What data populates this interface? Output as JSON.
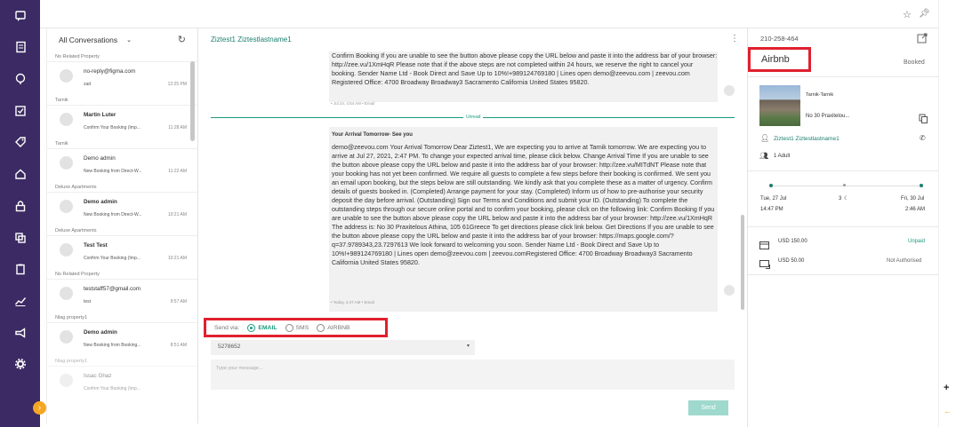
{
  "sidebar": {
    "items": [
      "chat-icon",
      "book-icon",
      "brain-icon",
      "checklist-icon",
      "tag-icon",
      "home-icon",
      "lock-icon",
      "copy-icon",
      "clipboard-icon",
      "analytics-icon",
      "megaphone-icon",
      "settings-icon"
    ]
  },
  "conversations": {
    "filter_label": "All Conversations",
    "groups": [
      {
        "label": "No Related Property",
        "name": "no-reply@figma.com",
        "preview": "zad",
        "time": "12:25 PM",
        "bold": false
      },
      {
        "label": "Tarnik",
        "name": "Martin Luter",
        "preview": "Confirm Your Booking (Imp...",
        "time": "11:28 AM",
        "bold": true
      },
      {
        "label": "Tarnik",
        "name": "Demo admin",
        "preview": "New Booking from Direct-W...",
        "time": "11:22 AM",
        "bold": false
      },
      {
        "label": "Deluxe Apartments",
        "name": "Demo admin",
        "preview": "New Booking from Direct-W...",
        "time": "10:21 AM",
        "bold": true
      },
      {
        "label": "Deluxe Apartments",
        "name": "Test Test",
        "preview": "Confirm Your Booking (Imp...",
        "time": "10:21 AM",
        "bold": true
      },
      {
        "label": "No Related Property",
        "name": "teststaff57@gmail.com",
        "preview": "test",
        "time": "9:57 AM",
        "bold": false
      },
      {
        "label": "Nlag property1",
        "name": "Demo admin",
        "preview": "New Booking from Booking...",
        "time": "8:51 AM",
        "bold": true
      },
      {
        "label": "Nlag property1",
        "name": "Issac Ghaz",
        "preview": "Confirm Your Booking (Imp...",
        "time": "",
        "bold": false
      }
    ]
  },
  "chat": {
    "title": "Ziztest1 Ziztestlastname1",
    "msg1": {
      "body": "Confirm Booking If you are unable to see the button above please copy the URL below and paste it into the address bar of your browser: http://zee.vu/1XmHqR Please note that if the above steps are not completed within 24 hours, we reserve the right to cancel your booking. Sender Name Ltd - Book Direct and Save Up to 10%!+989124769180 | Lines open demo@zeevou.com | zeevou.com Registered Office: 4700 Broadway Broadway3 Sacramento California United States 95820.",
      "meta": "• Jul 24, 4:54 AM • Email"
    },
    "unread_label": "Unread",
    "msg2": {
      "title": "Your Arrival Tomorrow- See you",
      "body": "demo@zeevou.com Your Arrival Tomorrow Dear Ziztest1, We are expecting you to arrive at Tarnik tomorrow. We are expecting you to arrive at Jul 27, 2021, 2:47 PM. To change your expected arrival time, please click below. Change Arrival Time If you are unable to see the button above please copy the URL below and paste it into the address bar of your browser: http://zee.vu/MITdNT Please note that your booking has not yet been confirmed. We require all guests to complete a few steps before their booking is confirmed. We sent you an email upon booking, but the steps below are still outstanding. We kindly ask that you complete these as a matter of urgency. Confirm details of guests booked in. (Completed) Arrange payment for your stay. (Completed) Inform us of how to pre-authorise your security deposit the day before arrival. (Outstanding) Sign our Terms and Conditions and submit your ID. (Outstanding) To complete the outstanding steps through our secure online portal and to confirm your booking, please click on the following link: Confirm Booking If you are unable to see the button above please copy the URL below and paste it into the address bar of your browser: http://zee.vu/1XmHqR The address is: No 30 Praxitelous Athina, 105 61Greece To get directions please click link below. Get Directions If you are unable to see the button above please copy the URL below and paste it into the address bar of your browser: https://maps.google.com/?q=37.9789343,23.7297613 We look forward to welcoming you soon. Sender Name Ltd - Book Direct and Save Up to 10%!+989124769180 | Lines open demo@zeevou.com | zeevou.comRegistered Office: 4700 Broadway Broadway3 Sacramento California United States 95820.",
      "meta": "• Today, 4:47 AM • Email"
    },
    "send_via_label": "Send via:",
    "channels": [
      {
        "label": "EMAIL",
        "selected": true
      },
      {
        "label": "SMS",
        "selected": false
      },
      {
        "label": "AIRBNB",
        "selected": false
      }
    ],
    "phone_value": "5278652",
    "input_placeholder": "Type your message...",
    "send_label": "Send"
  },
  "details": {
    "phone": "210-258-464",
    "channel": "Airbnb",
    "status": "Booked",
    "property_name": "Tarnik-Tarnik",
    "property_address": "No 30 Praxitelou...",
    "guest_name": "Ziztest1 Ziztestlastname1",
    "guests": "1 Adult",
    "checkin_date": "Tue, 27 Jul",
    "checkin_time": "14:47 PM",
    "nights": "3",
    "checkout_date": "Fri, 30 Jul",
    "checkout_time": "2:46 AM",
    "payments": [
      {
        "amount": "USD 150.00",
        "status": "Unpaid",
        "color": "#1a9a7f"
      },
      {
        "amount": "USD 50.00",
        "status": "Not Authorised",
        "color": "#666666"
      }
    ]
  }
}
